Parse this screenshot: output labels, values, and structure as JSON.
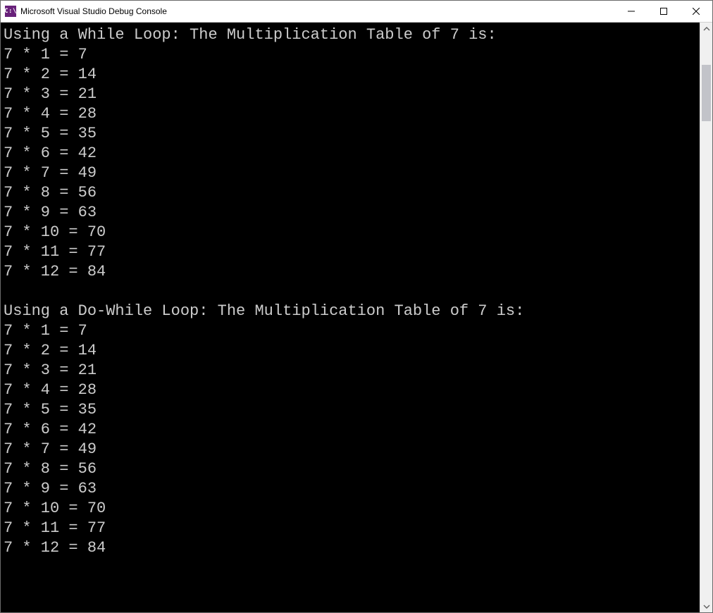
{
  "window": {
    "icon_text": "C:\\",
    "title": "Microsoft Visual Studio Debug Console"
  },
  "console": {
    "lines": [
      "Using a While Loop: The Multiplication Table of 7 is:",
      "7 * 1 = 7",
      "7 * 2 = 14",
      "7 * 3 = 21",
      "7 * 4 = 28",
      "7 * 5 = 35",
      "7 * 6 = 42",
      "7 * 7 = 49",
      "7 * 8 = 56",
      "7 * 9 = 63",
      "7 * 10 = 70",
      "7 * 11 = 77",
      "7 * 12 = 84",
      "",
      "Using a Do-While Loop: The Multiplication Table of 7 is:",
      "7 * 1 = 7",
      "7 * 2 = 14",
      "7 * 3 = 21",
      "7 * 4 = 28",
      "7 * 5 = 35",
      "7 * 6 = 42",
      "7 * 7 = 49",
      "7 * 8 = 56",
      "7 * 9 = 63",
      "7 * 10 = 70",
      "7 * 11 = 77",
      "7 * 12 = 84"
    ]
  }
}
